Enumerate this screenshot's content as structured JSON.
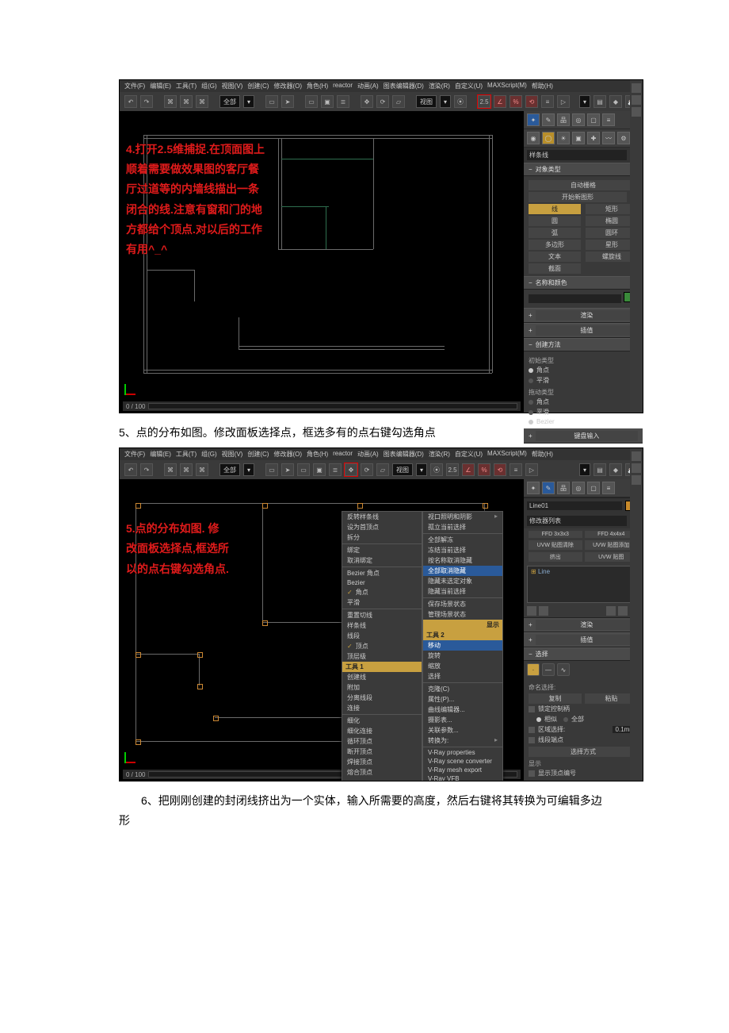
{
  "captions": {
    "c5": "5、点的分布如图。修改面板选择点，框选多有的点右键勾选角点",
    "c6": "6、把刚刚创建的封闭线挤出为一个实体，输入所需要的高度，然后右键将其转换为可编辑多边形"
  },
  "menubar": [
    "文件(F)",
    "编辑(E)",
    "工具(T)",
    "组(G)",
    "视图(V)",
    "创建(C)",
    "修改器(O)",
    "角色(H)",
    "reactor",
    "动画(A)",
    "图表编辑器(D)",
    "渲染(R)",
    "自定义(U)",
    "MAXScript(M)",
    "帮助(H)"
  ],
  "toolbar": {
    "dropdown": "全部",
    "viewlabel": "视图"
  },
  "timebar": {
    "frame": "0 / 100"
  },
  "annotations": {
    "s4": "4.打开2.5维捕捉.在顶面图上顺着需要做效果图的客厅餐厅过道等的内墙线描出一条闭合的线.注意有窗和门的地方都给个顶点.对以后的工作有用^_^",
    "s5": "5.点的分布如图. 修改面板选择点,框选所以的点右键勾选角点."
  },
  "panel1": {
    "dropdown": "样条线",
    "rollouts": {
      "objtype": "对象类型",
      "autogrid": "自动栅格",
      "startnew": "开始新图形",
      "namecolor": "名称和颜色",
      "render": "渲染",
      "interp": "插值",
      "create": "创建方法",
      "kbd": "键盘输入"
    },
    "shapes": {
      "line": "线",
      "rect": "矩形",
      "circle": "圆",
      "ellipse": "椭圆",
      "arc": "弧",
      "donut": "圆环",
      "ngon": "多边形",
      "star": "星形",
      "text": "文本",
      "helix": "螺旋线",
      "section": "截面"
    },
    "create_sec": {
      "init": "初始类型",
      "corner": "角点",
      "smooth": "平滑",
      "drag": "拖动类型",
      "bezier": "Bezier"
    }
  },
  "panel2": {
    "objname": "Line01",
    "modlist_label": "修改器列表",
    "ffd3": "FFD 3x3x3",
    "ffd4": "FFD 4x4x4",
    "uvwclear": "UVW 贴图清除",
    "uvwadd": "UVW 贴图添加",
    "extr": "挤出",
    "uvwmap": "UVW 贴图",
    "stackitem": "Line",
    "rollouts": {
      "render": "渲染",
      "interp": "插值",
      "sel": "选择"
    },
    "named": "命名选择:",
    "copy": "复制",
    "paste": "粘贴",
    "lock": "锁定控制柄",
    "similar": "相似",
    "all": "全部",
    "area": "区域选择:",
    "areaval": "0.1mm",
    "segend": "线段端点",
    "method": "选择方式",
    "disp": "显示",
    "shownum": "显示顶点编号"
  },
  "quad": {
    "tl_head": "样条线",
    "tl": [
      "反转样条线",
      "设为首顶点",
      "拆分",
      "绑定",
      "取消绑定",
      "Bezier 角点",
      "Bezier",
      "角点",
      "平滑",
      "重置切线",
      "样条线",
      "线段",
      "顶点",
      "顶层级"
    ],
    "bl_head": "工具 1",
    "bl": [
      "创建线",
      "附加",
      "分离线段",
      "连接",
      "细化",
      "细化连接",
      "循环顶点",
      "断开顶点",
      "焊接顶点",
      "熔合顶点"
    ],
    "tr_head": "",
    "tr": [
      "视口照明和阴影",
      "孤立当前选择",
      "全部解冻",
      "冻结当前选择",
      "按名称取消隐藏",
      "全部取消隐藏",
      "隐藏未选定对象",
      "隐藏当前选择",
      "保存场景状态",
      "管理场景状态"
    ],
    "br_head": "工具 2",
    "br_top": "显示",
    "br": [
      "移动",
      "旋转",
      "缩放",
      "选择",
      "克隆(C)",
      "属性(P)...",
      "曲线编辑器...",
      "摄影表...",
      "关联参数...",
      "转换为:",
      "V-Ray properties",
      "V-Ray scene converter",
      "V-Ray mesh export",
      "V-Ray VFB"
    ]
  }
}
